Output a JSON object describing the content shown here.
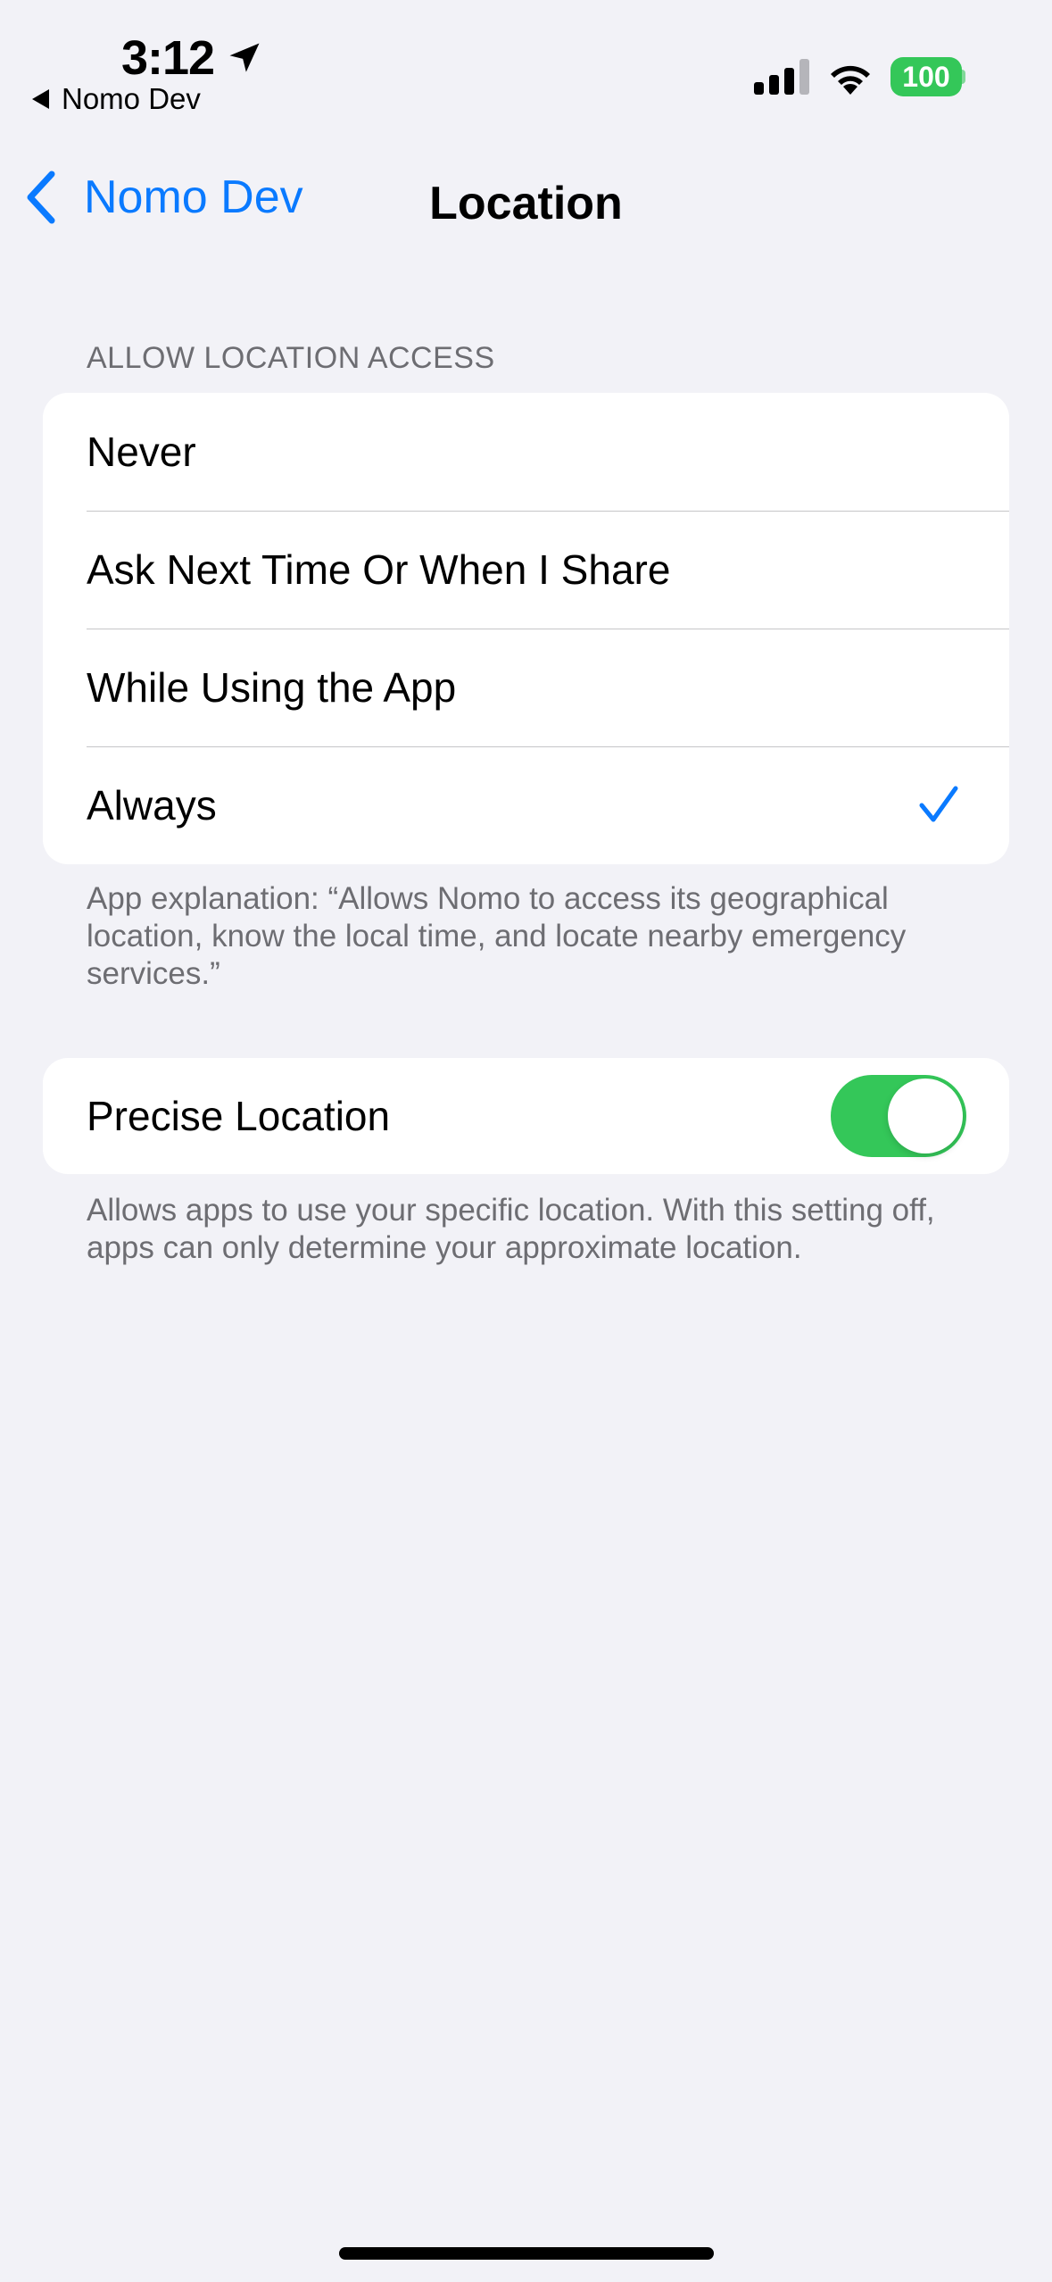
{
  "status_bar": {
    "time": "3:12",
    "back_app": "Nomo Dev",
    "battery": "100"
  },
  "nav": {
    "back_label": "Nomo Dev",
    "title": "Location"
  },
  "location_access": {
    "header": "ALLOW LOCATION ACCESS",
    "options": [
      {
        "label": "Never",
        "selected": false
      },
      {
        "label": "Ask Next Time Or When I Share",
        "selected": false
      },
      {
        "label": "While Using the App",
        "selected": false
      },
      {
        "label": "Always",
        "selected": true
      }
    ],
    "footer": "App explanation: “Allows Nomo to access its geographical location, know the local time, and locate nearby emergency services.”"
  },
  "precise_location": {
    "label": "Precise Location",
    "enabled": true,
    "footer": "Allows apps to use your specific location. With this setting off, apps can only determine your approximate location."
  },
  "colors": {
    "accent": "#0A7AFF",
    "toggle_on": "#34C759",
    "background": "#F2F2F7"
  }
}
